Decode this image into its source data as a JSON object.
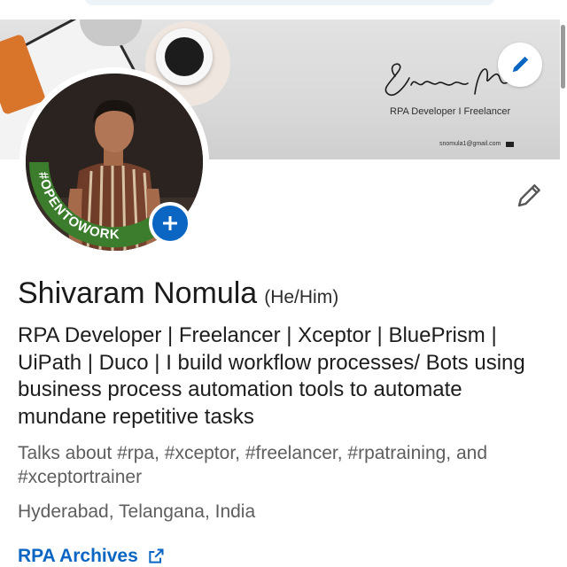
{
  "banner": {
    "signature_text": "Shivaram Nomula",
    "title": "RPA Developer I Freelancer",
    "email": "snomula1@gmail.com"
  },
  "profile": {
    "open_to_work_text": "#OPENTOWORK",
    "name": "Shivaram Nomula",
    "pronouns": "(He/Him)",
    "headline": "RPA Developer | Freelancer | Xceptor | BluePrism | UiPath | Duco | I build workflow processes/ Bots using business process automation tools to automate mundane repetitive tasks",
    "talks_about": "Talks about #rpa, #xceptor, #freelancer, #rpatraining, and #xceptortrainer",
    "location": "Hyderabad, Telangana, India",
    "website_label": "RPA Archives"
  },
  "icons": {
    "banner_edit": "pencil-icon",
    "profile_edit": "pencil-icon",
    "otw_add": "plus-icon",
    "external_link": "external-link-icon",
    "email": "envelope-icon"
  },
  "colors": {
    "accent": "#0a66c2",
    "open_to_work_green": "#3b7d2c"
  }
}
